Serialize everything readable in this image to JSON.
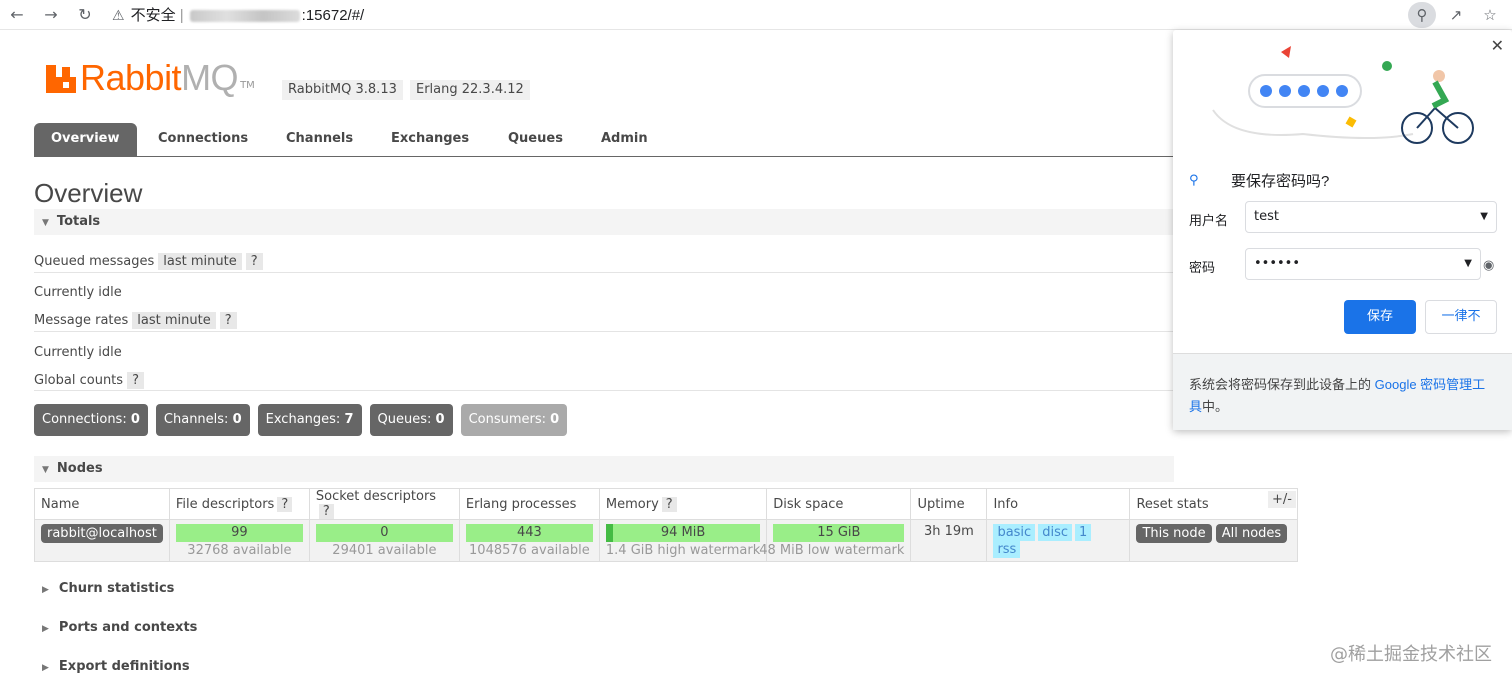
{
  "browser": {
    "security_label": "不安全",
    "url_suffix": ":15672/#/"
  },
  "header": {
    "logo_rabbit": "Rabbit",
    "logo_mq": "MQ",
    "logo_tm": "TM",
    "version_rabbitmq": "RabbitMQ 3.8.13",
    "version_erlang": "Erlang 22.3.4.12"
  },
  "tabs": [
    "Overview",
    "Connections",
    "Channels",
    "Exchanges",
    "Queues",
    "Admin"
  ],
  "page_title": "Overview",
  "totals": {
    "heading": "Totals",
    "queued_label": "Queued messages",
    "queued_range": "last minute",
    "help": "?",
    "queued_status": "Currently idle",
    "rates_label": "Message rates",
    "rates_range": "last minute",
    "rates_status": "Currently idle",
    "global_label": "Global counts"
  },
  "counts": [
    {
      "label": "Connections:",
      "value": "0"
    },
    {
      "label": "Channels:",
      "value": "0"
    },
    {
      "label": "Exchanges:",
      "value": "7"
    },
    {
      "label": "Queues:",
      "value": "0"
    },
    {
      "label": "Consumers:",
      "value": "0"
    }
  ],
  "nodes": {
    "heading": "Nodes",
    "columns": [
      "Name",
      "File descriptors",
      "Socket descriptors",
      "Erlang processes",
      "Memory",
      "Disk space",
      "Uptime",
      "Info",
      "Reset stats"
    ],
    "toggle": "+/-",
    "row": {
      "name": "rabbit@localhost",
      "fd": "99",
      "fd_sub": "32768 available",
      "sd": "0",
      "sd_sub": "29401 available",
      "ep": "443",
      "ep_sub": "1048576 available",
      "mem": "94 MiB",
      "mem_sub": "1.4 GiB high watermark",
      "disk": "15 GiB",
      "disk_sub": "48 MiB low watermark",
      "uptime": "3h 19m",
      "info": [
        "basic",
        "disc",
        "1",
        "rss"
      ],
      "reset": [
        "This node",
        "All nodes"
      ]
    }
  },
  "collapsed_sections": [
    "Churn statistics",
    "Ports and contexts",
    "Export definitions"
  ],
  "password_popup": {
    "title": "要保存密码吗?",
    "username_label": "用户名",
    "username_value": "test",
    "password_label": "密码",
    "password_value": "••••••",
    "save_label": "保存",
    "never_label": "一律不",
    "footer_text": "系统会将密码保存到此设备上的",
    "footer_link": "Google 密码管理工具",
    "footer_end": "中。"
  },
  "watermark": "@稀土掘金技术社区"
}
